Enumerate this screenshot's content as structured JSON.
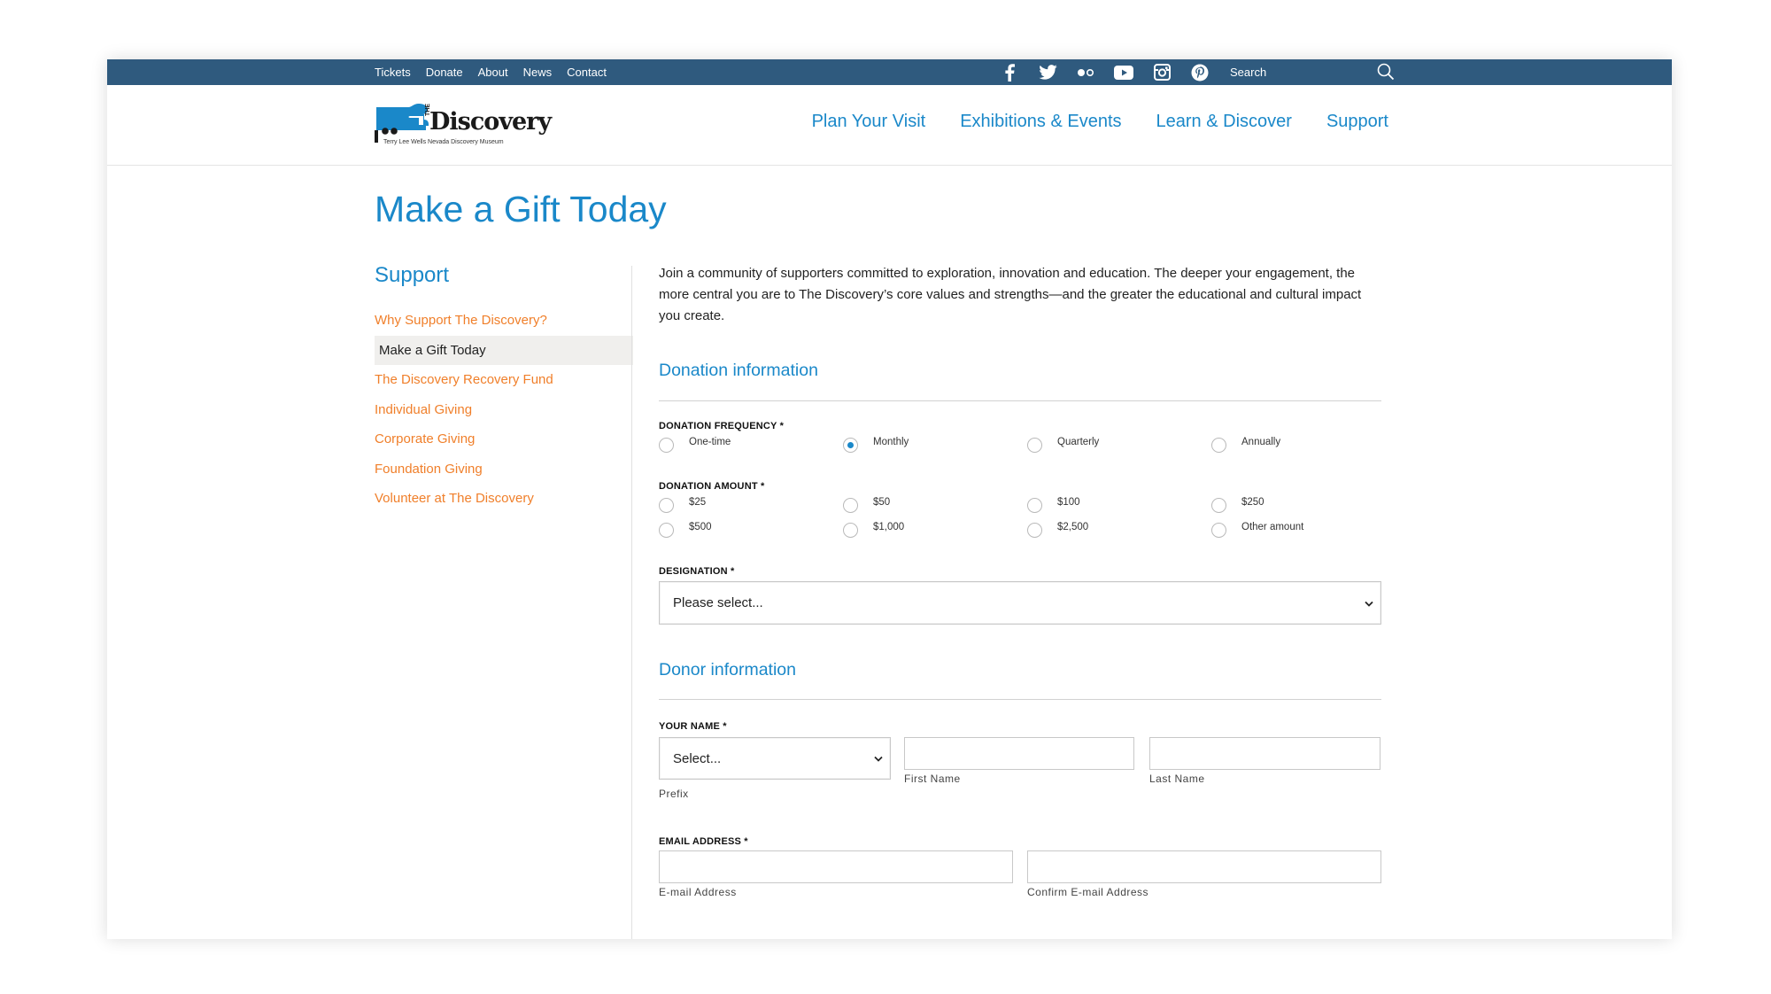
{
  "topbar": {
    "links": [
      "Tickets",
      "Donate",
      "About",
      "News",
      "Contact"
    ],
    "social_icons": [
      "facebook-icon",
      "twitter-icon",
      "flickr-icon",
      "youtube-icon",
      "instagram-icon",
      "pinterest-icon"
    ],
    "search_label": "Search",
    "bg_color": "#2f5a7e"
  },
  "header": {
    "logo_title": "Discovery",
    "logo_the": "THE",
    "logo_subtitle": "Terry Lee Wells Nevada Discovery Museum",
    "nav": [
      "Plan Your Visit",
      "Exhibitions & Events",
      "Learn & Discover",
      "Support"
    ]
  },
  "page": {
    "title": "Make a Gift Today"
  },
  "sidebar": {
    "title": "Support",
    "items": [
      "Why Support The Discovery?",
      "Make a Gift Today",
      "The Discovery Recovery Fund",
      "Individual Giving",
      "Corporate Giving",
      "Foundation Giving",
      "Volunteer at The Discovery"
    ],
    "active_index": 1
  },
  "content": {
    "intro": "Join a community of supporters committed to exploration, innovation and education. The deeper your engagement, the more central you are to The Discovery’s core values and strengths—and the greater the educational and cultural impact you create.",
    "donation_heading": "Donation information",
    "frequency_label": "DONATION FREQUENCY *",
    "frequency_options": [
      "One-time",
      "Monthly",
      "Quarterly",
      "Annually"
    ],
    "frequency_selected": "Monthly",
    "amount_label": "DONATION AMOUNT *",
    "amount_options": [
      "$25",
      "$50",
      "$100",
      "$250",
      "$500",
      "$1,000",
      "$2,500",
      "Other amount"
    ],
    "designation_label": "DESIGNATION *",
    "designation_value": "Please select...",
    "donor_heading": "Donor information",
    "name_label": "YOUR NAME *",
    "prefix_value": "Select...",
    "prefix_sublabel": "Prefix",
    "first_name_sublabel": "First Name",
    "first_name_value": "",
    "last_name_sublabel": "Last Name",
    "last_name_value": "",
    "email_label": "EMAIL ADDRESS *",
    "email_sublabel": "E-mail Address",
    "email_value": "",
    "confirm_email_sublabel": "Confirm E-mail Address",
    "confirm_email_value": ""
  },
  "colors": {
    "accent_blue": "#1a88c9",
    "link_orange": "#f07f2a",
    "active_bg": "#f0efed"
  }
}
